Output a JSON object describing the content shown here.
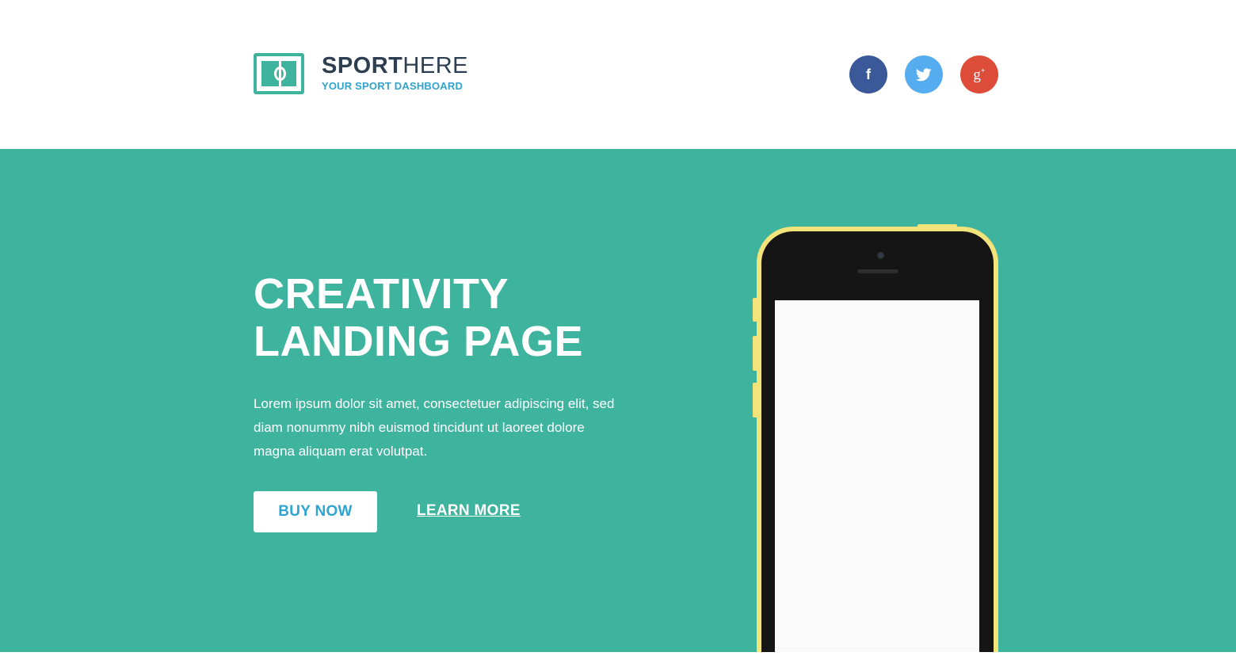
{
  "header": {
    "brand_bold": "SPORT",
    "brand_light": "HERE",
    "tagline": "YOUR SPORT DASHBOARD",
    "logo_icon": "soccer-field-icon"
  },
  "socials": [
    {
      "name": "facebook",
      "glyph": "f",
      "color": "#3b5998"
    },
    {
      "name": "twitter",
      "glyph": "twitter-bird",
      "color": "#55acee"
    },
    {
      "name": "google-plus",
      "glyph": "g+",
      "color": "#dd4b39"
    }
  ],
  "hero": {
    "title_line1": "CREATIVITY",
    "title_line2": "LANDING PAGE",
    "text": "Lorem ipsum dolor sit amet, consectetuer adipiscing elit, sed diam nonummy nibh euismod tincidunt ut laoreet dolore magna aliquam erat volutpat.",
    "buy_label": "BUY NOW",
    "learn_label": "LEARN MORE",
    "background": "#3eb39d"
  },
  "colors": {
    "accent": "#3eb39d",
    "link_blue": "#2fa4cf",
    "phone_yellow": "#f2e37a"
  }
}
